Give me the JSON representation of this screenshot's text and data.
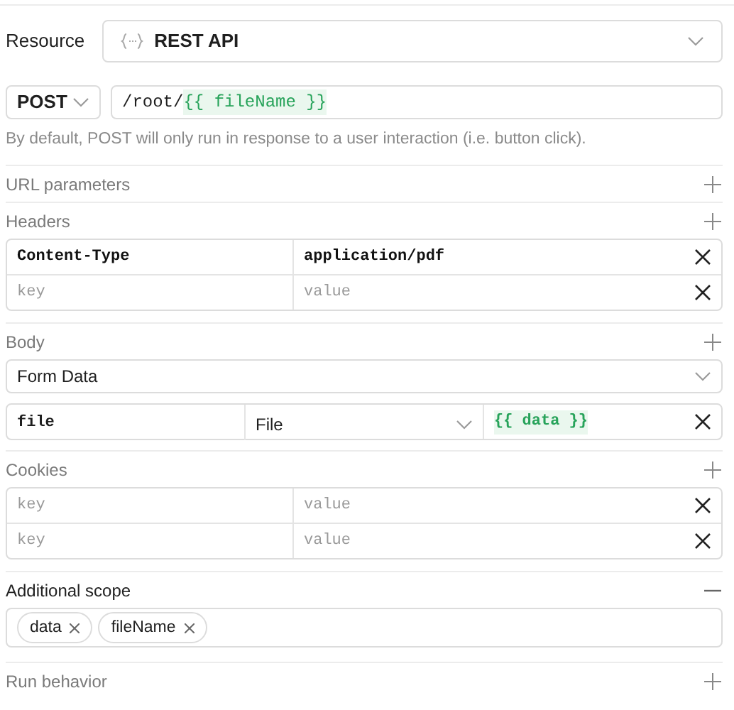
{
  "resource": {
    "label": "Resource",
    "value": "REST API"
  },
  "request": {
    "method": "POST",
    "url": [
      {
        "text": "/root/",
        "kind": "plain"
      },
      {
        "text": "{{ fileName }}",
        "kind": "template"
      }
    ],
    "hint": "By default, POST will only run in response to a user interaction (i.e. button click)."
  },
  "sections": [
    {
      "title": "URL parameters",
      "expanded": false,
      "kind": "none"
    },
    {
      "title": "Headers",
      "expanded": false,
      "kind": "pairs",
      "rows": [
        {
          "key": "Content-Type",
          "value": "application/pdf"
        },
        {
          "key_placeholder": "key",
          "value_placeholder": "value"
        }
      ]
    },
    {
      "title": "Body",
      "expanded": false,
      "kind": "body",
      "body_type": "Form Data",
      "rows": [
        {
          "key": "file",
          "type": "File",
          "value": "{{ data }}"
        }
      ]
    },
    {
      "title": "Cookies",
      "expanded": false,
      "kind": "pairs",
      "rows": [
        {
          "key_placeholder": "key",
          "value_placeholder": "value"
        },
        {
          "key_placeholder": "key",
          "value_placeholder": "value"
        }
      ]
    },
    {
      "title": "Additional scope",
      "expanded": true,
      "kind": "chips",
      "chips": [
        "data",
        "fileName"
      ]
    },
    {
      "title": "Run behavior",
      "expanded": false,
      "kind": "none"
    }
  ]
}
